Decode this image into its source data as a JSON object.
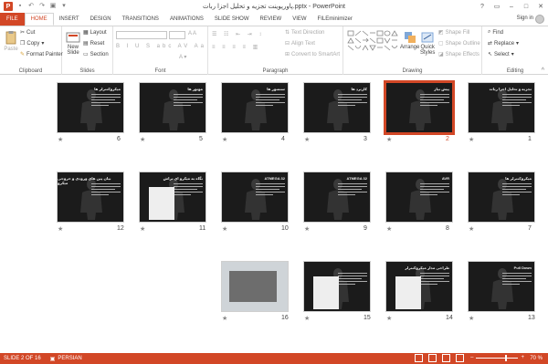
{
  "window": {
    "title": "پاورپوینت تجزیه و تحلیل اجزا ربات.pptx - PowerPoint",
    "app_logo": "P",
    "controls": [
      "?",
      "▭",
      "–",
      "□",
      "✕"
    ]
  },
  "qat": {
    "icons": [
      "save-icon",
      "undo-icon",
      "redo-icon",
      "start-slideshow-icon",
      "customize-qat-icon"
    ]
  },
  "tabs": [
    "FILE",
    "HOME",
    "INSERT",
    "DESIGN",
    "TRANSITIONS",
    "ANIMATIONS",
    "SLIDE SHOW",
    "REVIEW",
    "VIEW",
    "FILEminimizer"
  ],
  "active_tab": "HOME",
  "account": {
    "signin": "Sign in"
  },
  "ribbon": {
    "clipboard": {
      "label": "Clipboard",
      "paste": "Paste",
      "cut": "Cut",
      "copy": "Copy",
      "format_painter": "Format Painter"
    },
    "slides": {
      "label": "Slides",
      "new_slide": "New",
      "new_slide2": "Slide",
      "layout": "Layout",
      "reset": "Reset",
      "section": "Section"
    },
    "font": {
      "label": "Font"
    },
    "paragraph": {
      "label": "Paragraph",
      "text_direction": "Text Direction",
      "align_text": "Align Text",
      "convert_smartart": "Convert to SmartArt"
    },
    "drawing": {
      "label": "Drawing",
      "arrange": "Arrange",
      "quick_styles": "Quick",
      "quick_styles2": "Styles",
      "shape_fill": "Shape Fill",
      "shape_outline": "Shape Outline",
      "shape_effects": "Shape Effects"
    },
    "editing": {
      "label": "Editing",
      "find": "Find",
      "replace": "Replace",
      "select": "Select"
    }
  },
  "slides": [
    {
      "num": "1",
      "title": "تجزیه و تحلیل اجزا ربات"
    },
    {
      "num": "2",
      "title": "پیش نیاز",
      "selected": true
    },
    {
      "num": "3",
      "title": "کاربرد ها"
    },
    {
      "num": "4",
      "title": "سنسور ها"
    },
    {
      "num": "5",
      "title": "موتور ها"
    },
    {
      "num": "6",
      "title": "میکروکنترلر ها"
    },
    {
      "num": "7",
      "title": "میکروکنترلر ها"
    },
    {
      "num": "8",
      "title": "AVR"
    },
    {
      "num": "9",
      "title": "ATMEGA 32"
    },
    {
      "num": "10",
      "title": "ATMEGA 32"
    },
    {
      "num": "11",
      "title": "نگاه به میکرو ای تراش"
    },
    {
      "num": "12",
      "title": "بیان پین های ورودی و خروجی میکرو"
    },
    {
      "num": "13",
      "title": "Pull Down"
    },
    {
      "num": "14",
      "title": "طراحی مدار میکروکنترلر"
    },
    {
      "num": "15",
      "title": ""
    },
    {
      "num": "16",
      "title": ""
    }
  ],
  "status": {
    "slide_of": "SLIDE 2 OF 16",
    "language": "PERSIAN",
    "zoom": "70 %",
    "zoom_level": 0.7
  }
}
